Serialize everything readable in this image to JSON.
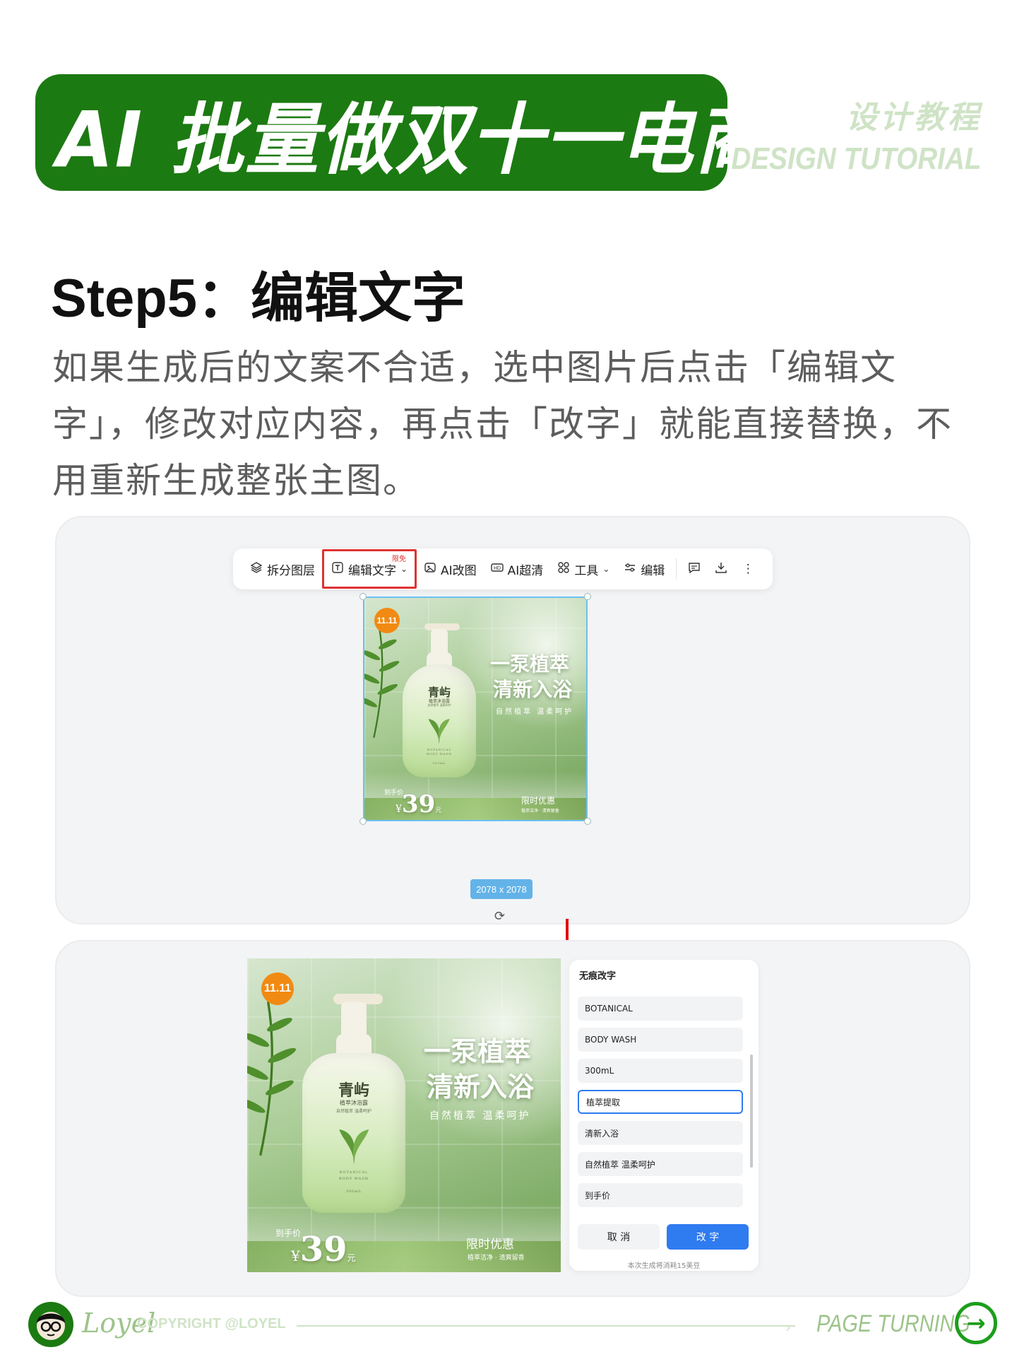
{
  "header": {
    "title": "AI 批量做双十一电商设计",
    "side_cn": "设计教程",
    "side_en": "DESIGN TUTORIAL"
  },
  "step": {
    "title": "Step5：编辑文字",
    "description": "如果生成后的文案不合适，选中图片后点击「编辑文字」，修改对应内容，再点击「改字」就能直接替换，不用重新生成整张主图。"
  },
  "toolbar": {
    "split_layers": "拆分图层",
    "limit_badge": "限免",
    "edit_text": "编辑文字",
    "ai_edit": "AI改图",
    "ai_hd": "AI超清",
    "tools": "工具",
    "edit": "编辑"
  },
  "product": {
    "badge": "11.11",
    "brand": "青屿",
    "product_name": "植萃沐浴露",
    "product_tag": "自然植萃 温柔呵护",
    "bottle_en1": "BOTANICAL",
    "bottle_en2": "BODY WASH",
    "bottle_volume": "300mL",
    "headline_1": "一泵植萃",
    "headline_2": "清新入浴",
    "subline": "自然植萃 温柔呵护",
    "price_label": "到手价",
    "currency": "¥",
    "price": "39",
    "yuan": "元",
    "promo": "限时优惠",
    "promo_sub": "植萃洁净 · 清爽留香"
  },
  "canvas": {
    "size_tag": "2078 x 2078"
  },
  "edit_panel": {
    "title": "无痕改字",
    "fields": [
      "BOTANICAL",
      "BODY WASH",
      "300mL",
      "植萃提取",
      "清新入浴",
      "自然植萃 温柔呵护",
      "到手价"
    ],
    "active_index": 3,
    "cancel": "取 消",
    "confirm": "改 字",
    "note": "本次生成将消耗15美豆"
  },
  "footer": {
    "logo": "Loyel",
    "copyright": "COPYRIGHT @LOYEL",
    "page_turning": "PAGE TURNING"
  },
  "colors": {
    "brand_green": "#1c7a12",
    "accent_red": "#e03131",
    "accent_blue": "#2f7bf0",
    "badge_orange": "#f18a12"
  }
}
